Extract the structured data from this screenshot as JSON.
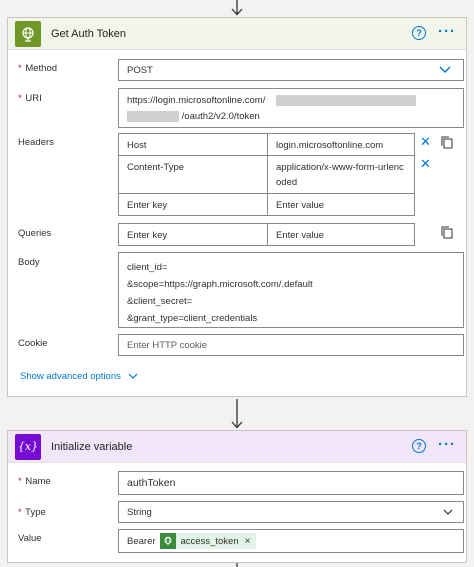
{
  "colors": {
    "accent": "#0078d4",
    "http_brand": "#709727",
    "variable_brand": "#770bd6",
    "required": "#a4262c"
  },
  "action1": {
    "title": "Get Auth Token",
    "icon": "globe-icon",
    "help": "?",
    "more": "···",
    "method": {
      "label": "Method",
      "required_mark": "*",
      "value": "POST"
    },
    "uri": {
      "label": "URI",
      "required_mark": "*",
      "line1": "https://login.microsoftonline.com/",
      "line2": "/oauth2/v2.0/token"
    },
    "headers": {
      "label": "Headers",
      "rows": [
        {
          "key": "Host",
          "value": "login.microsoftonline.com"
        },
        {
          "key": "Content-Type",
          "value": "application/x-www-form-urlencoded"
        }
      ],
      "key_placeholder": "Enter key",
      "value_placeholder": "Enter value"
    },
    "queries": {
      "label": "Queries",
      "key_placeholder": "Enter key",
      "value_placeholder": "Enter value"
    },
    "body": {
      "label": "Body",
      "lines": [
        "client_id=",
        "&scope=https://graph.microsoft.com/.default",
        "&client_secret=",
        "&grant_type=client_credentials"
      ]
    },
    "cookie": {
      "label": "Cookie",
      "placeholder": "Enter HTTP cookie"
    },
    "advanced": "Show advanced options"
  },
  "action2": {
    "title": "Initialize variable",
    "icon": "variable-icon",
    "icon_text": "{x}",
    "help": "?",
    "more": "···",
    "name": {
      "label": "Name",
      "required_mark": "*",
      "value": "authToken"
    },
    "type": {
      "label": "Type",
      "required_mark": "*",
      "value": "String"
    },
    "value": {
      "label": "Value",
      "prefix": "Bearer",
      "token": "access_token",
      "token_remove": "×"
    }
  }
}
